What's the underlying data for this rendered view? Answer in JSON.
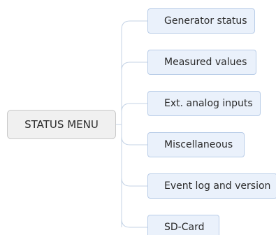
{
  "diagram": {
    "root": {
      "label": "STATUS MENU"
    },
    "children": [
      {
        "label": "Generator status"
      },
      {
        "label": "Measured values"
      },
      {
        "label": "Ext. analog inputs"
      },
      {
        "label": "Miscellaneous"
      },
      {
        "label": "Event log and version"
      },
      {
        "label": "SD-Card"
      }
    ],
    "colors": {
      "root_fill": "#f0f0f0",
      "root_border": "#c9c9c9",
      "child_fill": "#eaf1fb",
      "child_border": "#b9cde8",
      "connector": "#c4d3e6"
    }
  }
}
